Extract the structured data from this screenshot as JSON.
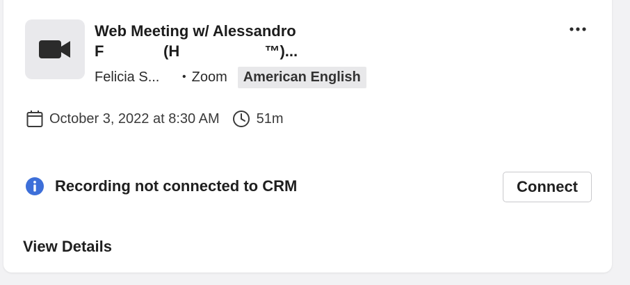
{
  "meeting": {
    "title_line1": "Web Meeting w/ Alessandro",
    "title_line2": "F              (H                    ™)...",
    "owner": "Felicia S...",
    "separator": "•",
    "platform": "Zoom",
    "language": "American English",
    "date": "October 3, 2022 at 8:30 AM",
    "duration": "51m"
  },
  "icons": {
    "thumbnail": "video-camera-icon",
    "more": "more-horizontal-icon",
    "date": "calendar-icon",
    "duration": "clock-icon",
    "info": "info-icon"
  },
  "crm": {
    "status": "Recording not connected to CRM",
    "connect_label": "Connect"
  },
  "footer": {
    "details_label": "View Details"
  },
  "colors": {
    "info": "#3d6fd9",
    "icon": "#3a3a3a",
    "tag_bg": "#e8e8ea"
  }
}
